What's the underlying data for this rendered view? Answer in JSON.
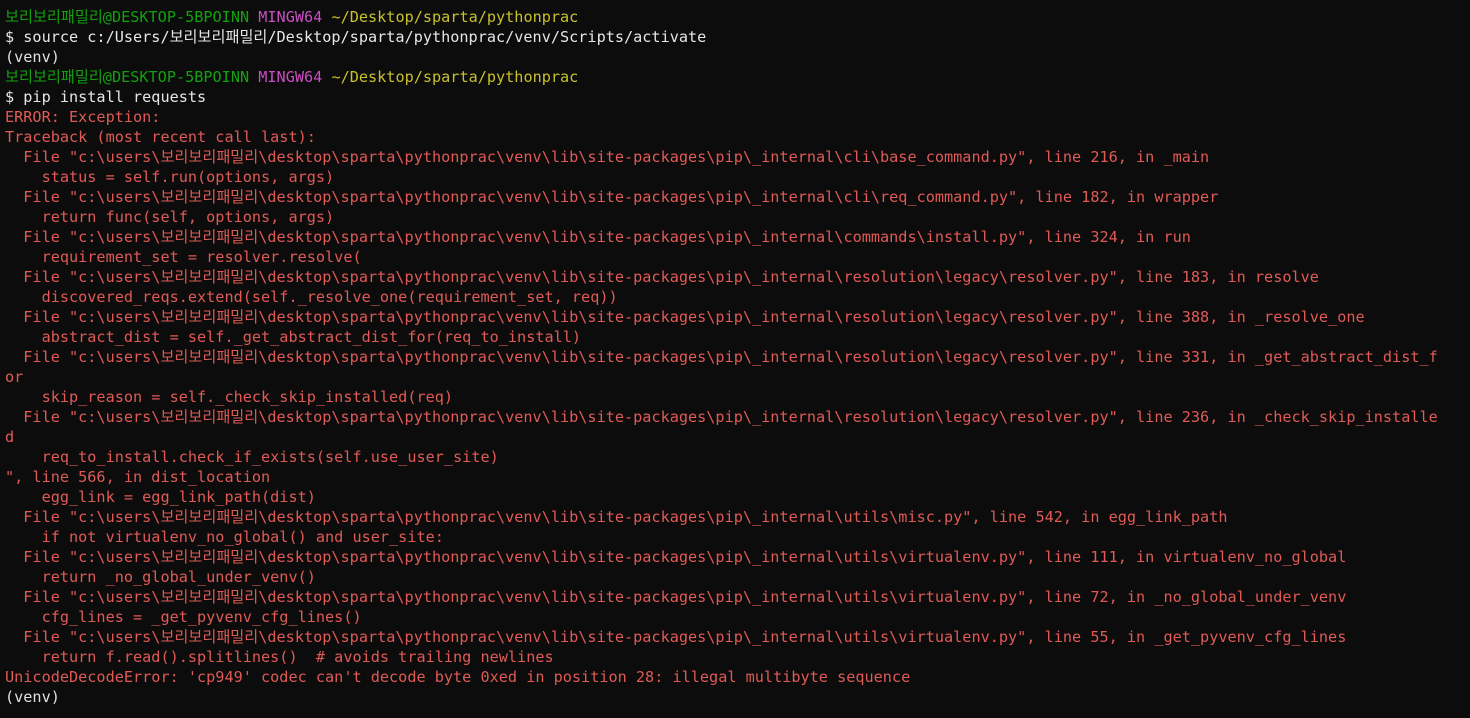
{
  "colors": {
    "background": "#0c0c0c",
    "user_host": "#13a10e",
    "system": "#c94ec2",
    "path": "#c9c12b",
    "command": "#e6e6e6",
    "error": "#e05a56"
  },
  "terminal": {
    "lines": [
      {
        "type": "prompt",
        "user": "보리보리패밀리@DESKTOP-5BPOINN",
        "system": "MINGW64",
        "path": "~/Desktop/sparta/pythonprac"
      },
      {
        "type": "command",
        "text": "$ source c:/Users/보리보리패밀리/Desktop/sparta/pythonprac/venv/Scripts/activate"
      },
      {
        "type": "plain",
        "text": "(venv)"
      },
      {
        "type": "prompt",
        "user": "보리보리패밀리@DESKTOP-5BPOINN",
        "system": "MINGW64",
        "path": "~/Desktop/sparta/pythonprac"
      },
      {
        "type": "command",
        "text": "$ pip install requests"
      },
      {
        "type": "error",
        "text": "ERROR: Exception:"
      },
      {
        "type": "error",
        "text": "Traceback (most recent call last):"
      },
      {
        "type": "error",
        "text": "  File \"c:\\users\\보리보리패밀리\\desktop\\sparta\\pythonprac\\venv\\lib\\site-packages\\pip\\_internal\\cli\\base_command.py\", line 216, in _main"
      },
      {
        "type": "error",
        "text": "    status = self.run(options, args)"
      },
      {
        "type": "error",
        "text": "  File \"c:\\users\\보리보리패밀리\\desktop\\sparta\\pythonprac\\venv\\lib\\site-packages\\pip\\_internal\\cli\\req_command.py\", line 182, in wrapper"
      },
      {
        "type": "error",
        "text": "    return func(self, options, args)"
      },
      {
        "type": "error",
        "text": "  File \"c:\\users\\보리보리패밀리\\desktop\\sparta\\pythonprac\\venv\\lib\\site-packages\\pip\\_internal\\commands\\install.py\", line 324, in run"
      },
      {
        "type": "error",
        "text": "    requirement_set = resolver.resolve("
      },
      {
        "type": "error",
        "text": "  File \"c:\\users\\보리보리패밀리\\desktop\\sparta\\pythonprac\\venv\\lib\\site-packages\\pip\\_internal\\resolution\\legacy\\resolver.py\", line 183, in resolve"
      },
      {
        "type": "error",
        "text": "    discovered_reqs.extend(self._resolve_one(requirement_set, req))"
      },
      {
        "type": "error",
        "text": "  File \"c:\\users\\보리보리패밀리\\desktop\\sparta\\pythonprac\\venv\\lib\\site-packages\\pip\\_internal\\resolution\\legacy\\resolver.py\", line 388, in _resolve_one"
      },
      {
        "type": "error",
        "text": "    abstract_dist = self._get_abstract_dist_for(req_to_install)"
      },
      {
        "type": "error",
        "text": "  File \"c:\\users\\보리보리패밀리\\desktop\\sparta\\pythonprac\\venv\\lib\\site-packages\\pip\\_internal\\resolution\\legacy\\resolver.py\", line 331, in _get_abstract_dist_f"
      },
      {
        "type": "error",
        "text": "or"
      },
      {
        "type": "error",
        "text": "    skip_reason = self._check_skip_installed(req)"
      },
      {
        "type": "error",
        "text": "  File \"c:\\users\\보리보리패밀리\\desktop\\sparta\\pythonprac\\venv\\lib\\site-packages\\pip\\_internal\\resolution\\legacy\\resolver.py\", line 236, in _check_skip_installe"
      },
      {
        "type": "error",
        "text": "d"
      },
      {
        "type": "error",
        "text": "    req_to_install.check_if_exists(self.use_user_site)"
      },
      {
        "type": "error",
        "text": "\", line 566, in dist_location"
      },
      {
        "type": "error",
        "text": "    egg_link = egg_link_path(dist)"
      },
      {
        "type": "error",
        "text": "  File \"c:\\users\\보리보리패밀리\\desktop\\sparta\\pythonprac\\venv\\lib\\site-packages\\pip\\_internal\\utils\\misc.py\", line 542, in egg_link_path"
      },
      {
        "type": "error",
        "text": "    if not virtualenv_no_global() and user_site:"
      },
      {
        "type": "error",
        "text": "  File \"c:\\users\\보리보리패밀리\\desktop\\sparta\\pythonprac\\venv\\lib\\site-packages\\pip\\_internal\\utils\\virtualenv.py\", line 111, in virtualenv_no_global"
      },
      {
        "type": "error",
        "text": "    return _no_global_under_venv()"
      },
      {
        "type": "error",
        "text": "  File \"c:\\users\\보리보리패밀리\\desktop\\sparta\\pythonprac\\venv\\lib\\site-packages\\pip\\_internal\\utils\\virtualenv.py\", line 72, in _no_global_under_venv"
      },
      {
        "type": "error",
        "text": "    cfg_lines = _get_pyvenv_cfg_lines()"
      },
      {
        "type": "error",
        "text": "  File \"c:\\users\\보리보리패밀리\\desktop\\sparta\\pythonprac\\venv\\lib\\site-packages\\pip\\_internal\\utils\\virtualenv.py\", line 55, in _get_pyvenv_cfg_lines"
      },
      {
        "type": "error",
        "text": "    return f.read().splitlines()  # avoids trailing newlines"
      },
      {
        "type": "error",
        "text": "UnicodeDecodeError: 'cp949' codec can't decode byte 0xed in position 28: illegal multibyte sequence"
      },
      {
        "type": "plain",
        "text": "(venv)"
      }
    ]
  }
}
